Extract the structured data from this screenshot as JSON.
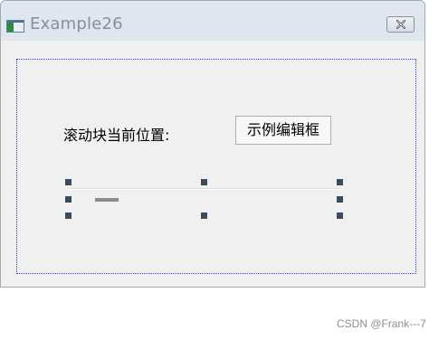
{
  "window": {
    "title": "Example26",
    "icon": "app-window-icon",
    "close_icon": "close-x-icon"
  },
  "client": {
    "position_label": "滚动块当前位置:",
    "edit_button_label": "示例编辑框"
  },
  "slider": {
    "icon": "slider-thumb",
    "value_fraction": 0.1
  },
  "watermark": "CSDN @Frank---7"
}
